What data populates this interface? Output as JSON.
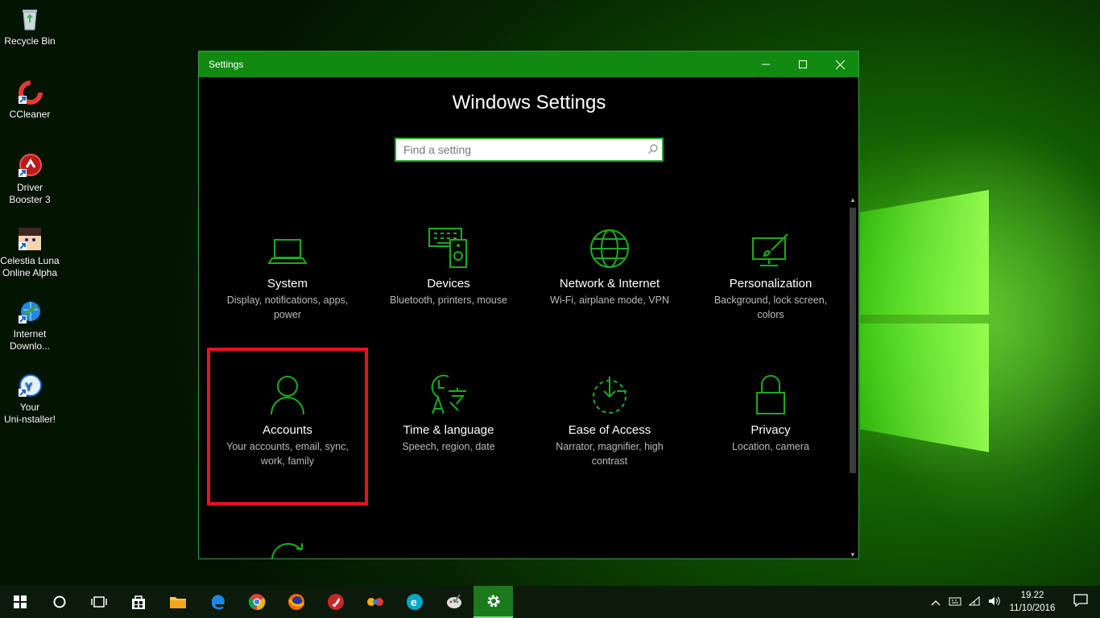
{
  "desktop": {
    "icons": [
      {
        "label": "Recycle Bin"
      },
      {
        "label": "CCleaner"
      },
      {
        "label": "Driver Booster 3"
      },
      {
        "label": "Celestia Luna Online Alpha"
      },
      {
        "label": "Internet Downlo..."
      },
      {
        "label": "Your Uni-nstaller!"
      }
    ]
  },
  "window": {
    "title": "Settings",
    "heading": "Windows Settings",
    "search_placeholder": "Find a setting",
    "accent_color": "#128a12",
    "selection_color": "#e81123",
    "tiles": [
      {
        "name": "System",
        "desc": "Display, notifications, apps, power",
        "icon": "laptop-icon"
      },
      {
        "name": "Devices",
        "desc": "Bluetooth, printers, mouse",
        "icon": "keyboard-speaker-icon"
      },
      {
        "name": "Network & Internet",
        "desc": "Wi-Fi, airplane mode, VPN",
        "icon": "globe-icon"
      },
      {
        "name": "Personalization",
        "desc": "Background, lock screen, colors",
        "icon": "paint-brush-icon"
      },
      {
        "name": "Accounts",
        "desc": "Your accounts, email, sync, work, family",
        "icon": "person-icon",
        "selected": true
      },
      {
        "name": "Time & language",
        "desc": "Speech, region, date",
        "icon": "clock-language-icon"
      },
      {
        "name": "Ease of Access",
        "desc": "Narrator, magnifier, high contrast",
        "icon": "ease-of-access-icon"
      },
      {
        "name": "Privacy",
        "desc": "Location, camera",
        "icon": "padlock-icon"
      }
    ]
  },
  "taskbar": {
    "clock_time": "19.22",
    "clock_date": "11/10/2016"
  }
}
